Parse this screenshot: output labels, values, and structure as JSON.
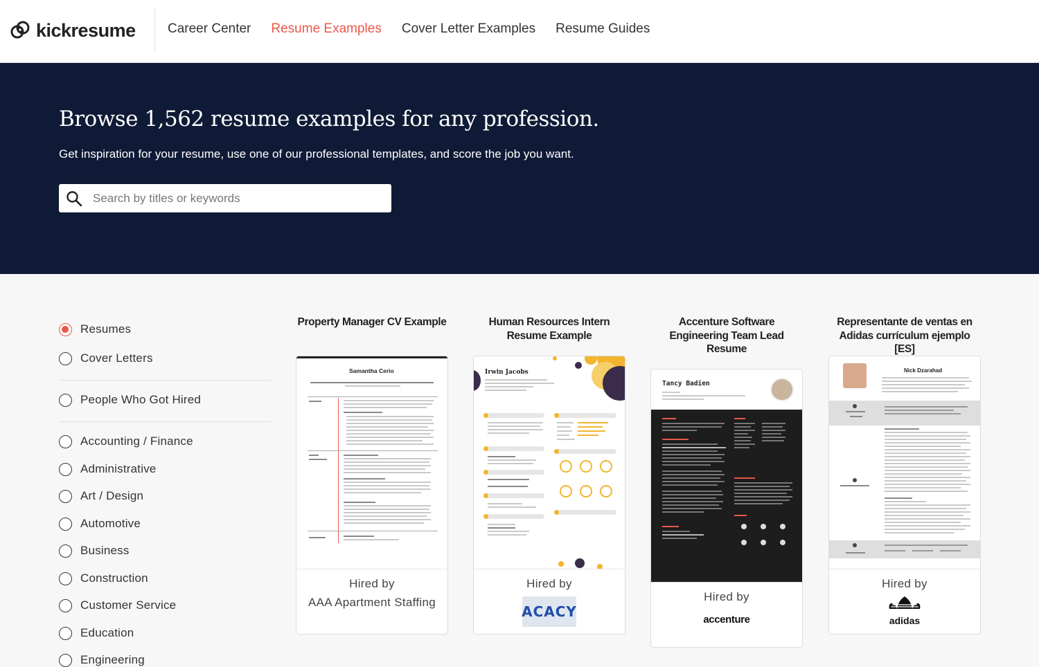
{
  "brand": {
    "name": "kickresume"
  },
  "nav": {
    "items": [
      {
        "label": "Career Center"
      },
      {
        "label": "Resume Examples"
      },
      {
        "label": "Cover Letter Examples"
      },
      {
        "label": "Resume Guides"
      }
    ]
  },
  "hero": {
    "title": "Browse 1,562 resume examples for any profession.",
    "subtitle": "Get inspiration for your resume, use one of our professional templates, and score the job you want.",
    "search_placeholder": "Search by titles or keywords"
  },
  "filters": {
    "type": [
      {
        "label": "Resumes",
        "checked": true
      },
      {
        "label": "Cover Letters",
        "checked": false
      }
    ],
    "special": {
      "label": "People Who Got Hired",
      "checked": false
    },
    "categories": [
      {
        "label": "Accounting / Finance"
      },
      {
        "label": "Administrative"
      },
      {
        "label": "Art / Design"
      },
      {
        "label": "Automotive"
      },
      {
        "label": "Business"
      },
      {
        "label": "Construction"
      },
      {
        "label": "Customer Service"
      },
      {
        "label": "Education"
      },
      {
        "label": "Engineering"
      }
    ]
  },
  "cards": [
    {
      "title": "Property Manager CV Example",
      "hired_label": "Hired by",
      "company": "AAA Apartment Staffing",
      "resume_name": "Samantha Cerio"
    },
    {
      "title": "Human Resources Intern Resume Example",
      "hired_label": "Hired by",
      "company": "ACACY",
      "resume_name": "Irwin Jacobs"
    },
    {
      "title": "Accenture Software Engineering Team Lead Resume",
      "hired_label": "Hired by",
      "company": "accenture",
      "resume_name": "Tancy Badien"
    },
    {
      "title": "Representante de ventas en Adidas currículum ejemplo [ES]",
      "hired_label": "Hired by",
      "company": "adidas",
      "resume_name": "Nick Dzarahad"
    }
  ],
  "colors": {
    "accent": "#e9584a",
    "hero_bg": "#0f1a36"
  }
}
